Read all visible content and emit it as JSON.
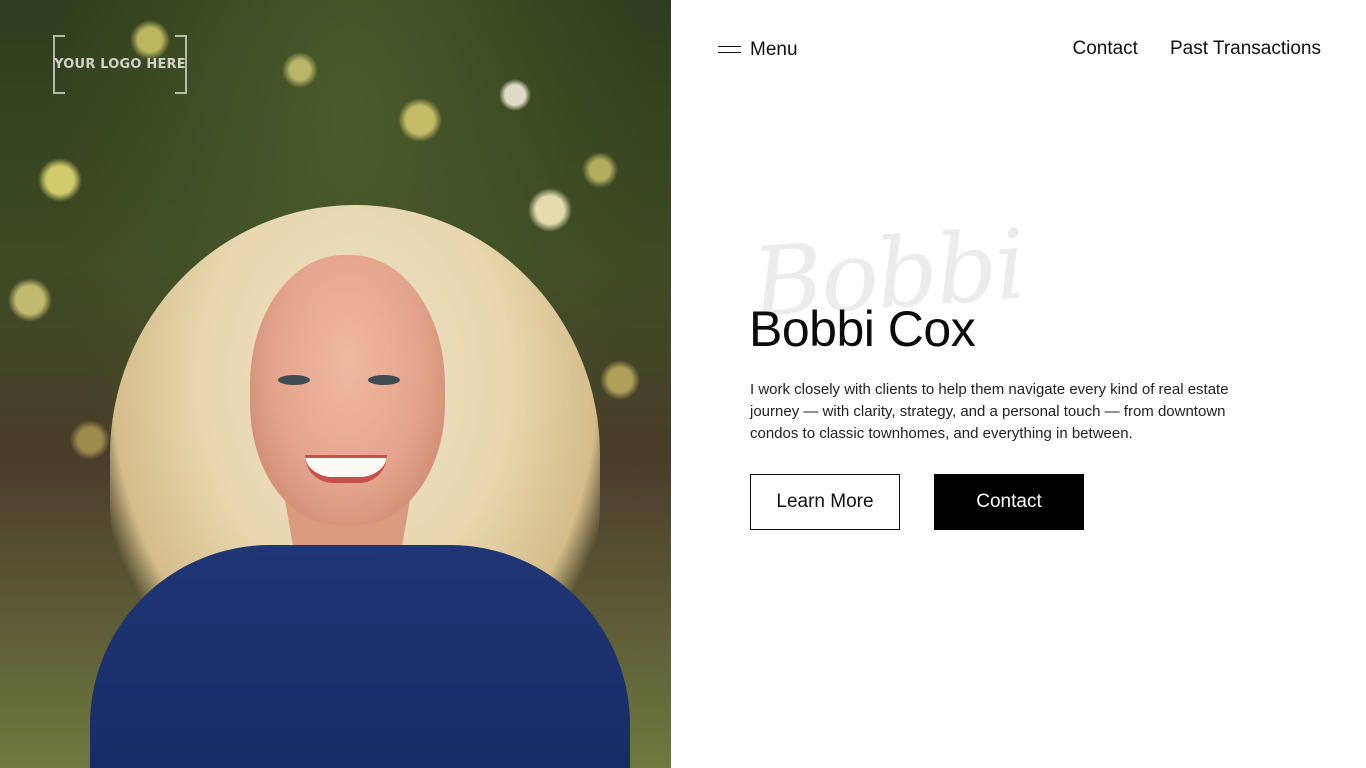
{
  "logo": {
    "text": "YOUR LOGO HERE"
  },
  "nav": {
    "menu_label": "Menu",
    "links": [
      "Contact",
      "Past Transactions"
    ]
  },
  "hero": {
    "script_text": "Bobbi",
    "name": "Bobbi Cox",
    "bio": "I work closely with clients to help them navigate every kind of real estate journey — with clarity, strategy, and a personal touch — from downtown condos to classic townhomes, and everything in between.",
    "learn_more_label": "Learn More",
    "contact_label": "Contact"
  },
  "colors": {
    "primary_button": "#000000",
    "text": "#111111",
    "background": "#ffffff"
  }
}
